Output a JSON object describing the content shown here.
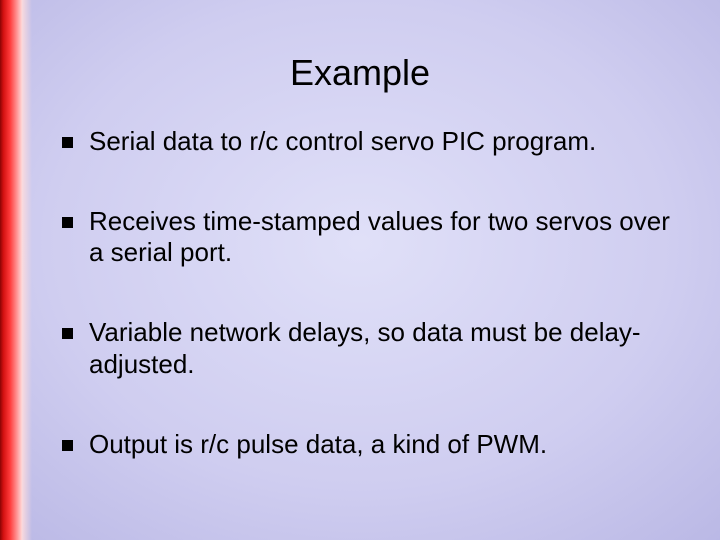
{
  "title": "Example",
  "bullets": [
    "Serial data to r/c control servo PIC program.",
    "Receives time-stamped values for two servos over a serial port.",
    "Variable network delays, so data must be delay-adjusted.",
    "Output is r/c pulse data, a kind of PWM."
  ]
}
